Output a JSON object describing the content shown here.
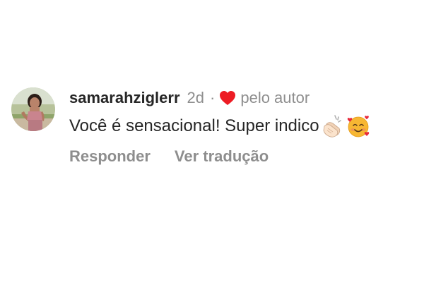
{
  "comment": {
    "username": "samarahziglerr",
    "time": "2d",
    "separator": "·",
    "liked_by_label": "pelo autor",
    "text": "Você é sensacional! Super indico",
    "emojis": [
      "clapping-hands-emoji",
      "smiling-face-with-hearts-emoji"
    ],
    "actions": {
      "reply": "Responder",
      "translate": "Ver tradução"
    },
    "heart_color": "#ed1c24"
  }
}
